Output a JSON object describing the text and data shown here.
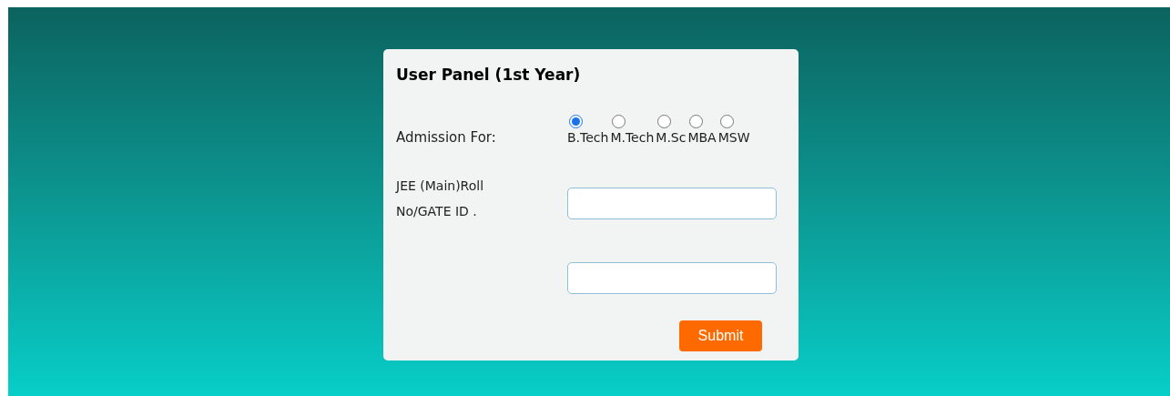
{
  "panel": {
    "title": "User Panel (1st Year)"
  },
  "fields": [
    {
      "kind": "radio",
      "label": "Admission For:",
      "options": [
        {
          "label": "B.Tech",
          "selected": true
        },
        {
          "label": "M.Tech",
          "selected": false
        },
        {
          "label": "M.Sc",
          "selected": false
        },
        {
          "label": "MBA",
          "selected": false
        },
        {
          "label": "MSW",
          "selected": false
        }
      ]
    },
    {
      "kind": "text",
      "label": "JEE (Main)Roll No/GATE ID ."
    },
    {
      "kind": "text"
    }
  ],
  "submit_button": "Submit"
}
